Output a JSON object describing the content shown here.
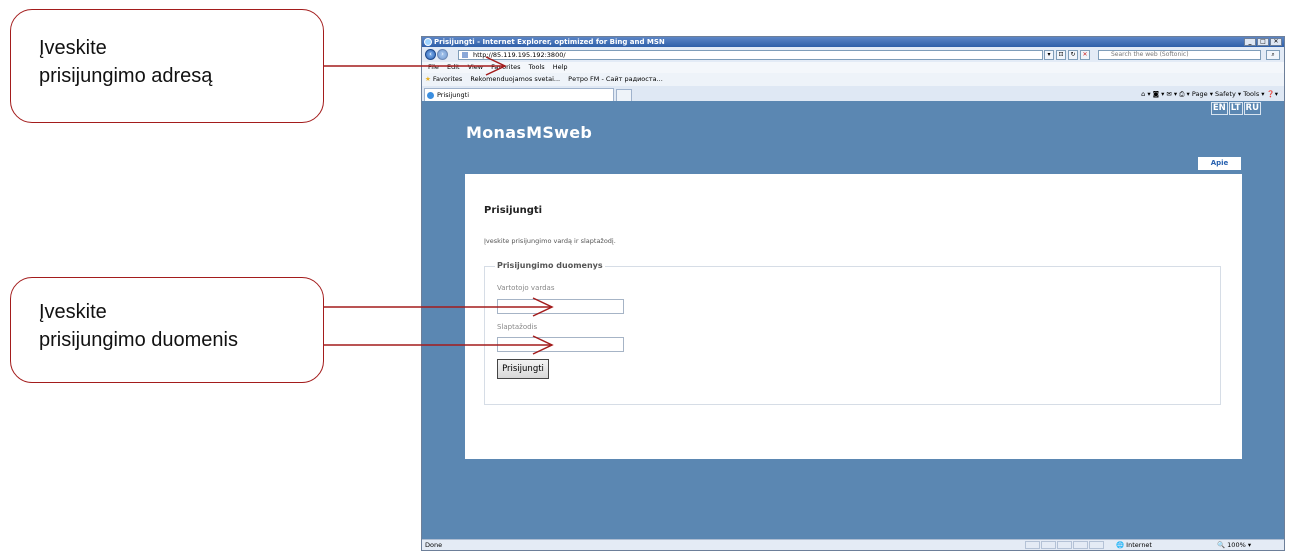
{
  "callouts": {
    "address": {
      "line1": "Įveskite",
      "line2": "prisijungimo adresą"
    },
    "credentials": {
      "line1": "Įveskite",
      "line2": "prisijungimo duomenis"
    }
  },
  "browser": {
    "window_title": "Prisijungti - Internet Explorer, optimized for Bing and MSN",
    "address": "http://85.119.195.192:3800/",
    "search_placeholder": "Search the web (Softonic)",
    "menu": [
      "File",
      "Edit",
      "View",
      "Favorites",
      "Tools",
      "Help"
    ],
    "favorites_label": "Favorites",
    "favorites_items": [
      "Rekomenduojamos svetai...",
      "Ретро FM - Сайт радиоста..."
    ],
    "tab_title": "Prisijungti",
    "command_bar": "Page ▾  Safety ▾  Tools ▾",
    "status_left": "Done",
    "status_zone": "Internet",
    "status_zoom": "100%"
  },
  "page": {
    "languages": [
      "EN",
      "LT",
      "RU"
    ],
    "brand": "MonasMSweb",
    "nav_apie": "Apie",
    "heading": "Prisijungti",
    "intro": "Įveskite prisijungimo vardą ir slaptažodį.",
    "fieldset_legend": "Prisijungimo duomenys",
    "username_label": "Vartotojo vardas",
    "username_value": "",
    "password_label": "Slaptažodis",
    "password_value": "",
    "submit_label": "Prisijungti"
  },
  "colors": {
    "accent_red": "#a31c1c",
    "page_background": "#5b87b2",
    "brand_text": "#ffffff"
  }
}
